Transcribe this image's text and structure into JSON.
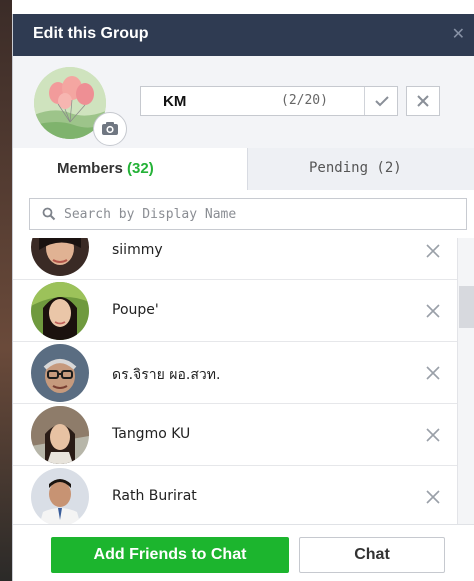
{
  "dialog": {
    "title": "Edit this Group",
    "close_icon": "close-icon"
  },
  "group": {
    "name": "KM",
    "name_count": "(2/20)",
    "camera_icon": "camera-icon",
    "confirm_icon": "checkmark-icon",
    "cancel_icon": "close-icon"
  },
  "tabs": {
    "members_label": "Members",
    "members_count": "(32)",
    "pending_label": "Pending (2)"
  },
  "search": {
    "placeholder": "Search by Display Name",
    "icon": "search-icon"
  },
  "members": [
    {
      "name": "siimmy"
    },
    {
      "name": "Poupe'"
    },
    {
      "name": "ดร.จิราย ผอ.สวท."
    },
    {
      "name": "Tangmo KU"
    },
    {
      "name": "Rath Burirat"
    }
  ],
  "footer": {
    "add_friends_label": "Add Friends to Chat",
    "chat_label": "Chat"
  },
  "colors": {
    "title_bar": "#2f3b52",
    "accent_green": "#1cb52e",
    "count_green": "#25b238"
  }
}
